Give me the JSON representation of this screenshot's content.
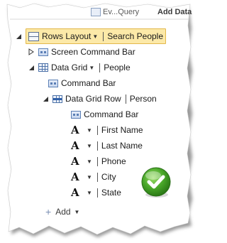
{
  "tabs": [
    "Ev...Query",
    "Add Data"
  ],
  "tree": {
    "root": {
      "label": "Rows Layout",
      "name": "Search People"
    },
    "screen_command_bar": "Screen Command Bar",
    "data_grid": {
      "label": "Data Grid",
      "name": "People"
    },
    "command_bar": "Command Bar",
    "data_grid_row": {
      "label": "Data Grid Row",
      "name": "Person"
    },
    "row_command_bar": "Command Bar",
    "fields": [
      "First Name",
      "Last Name",
      "Phone",
      "City",
      "State"
    ],
    "add_label": "Add"
  },
  "colors": {
    "selection_fill": "#fce9a8",
    "selection_border": "#e3b84b",
    "check_green": "#3fa32b"
  }
}
